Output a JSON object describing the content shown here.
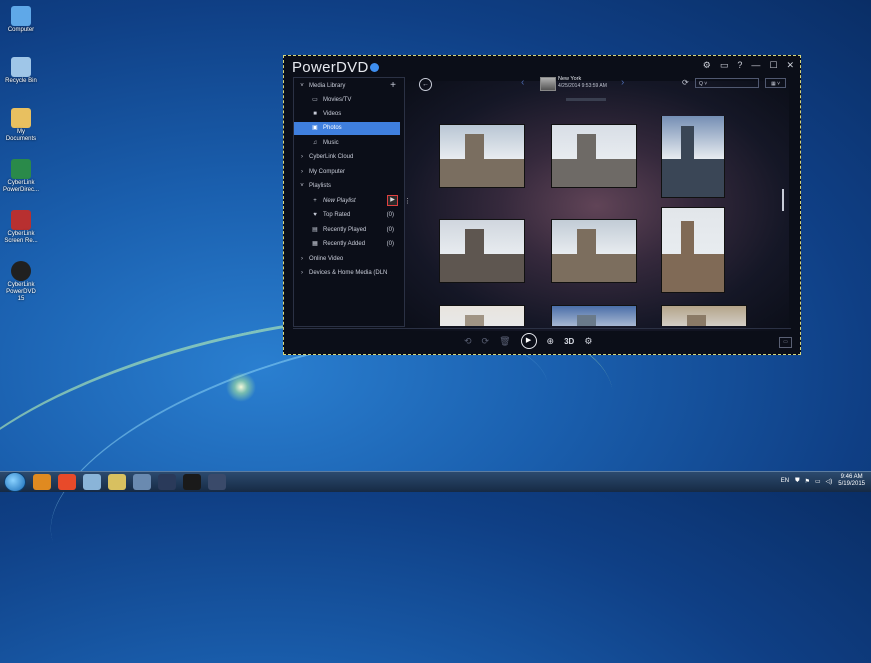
{
  "desktop": {
    "icons": [
      {
        "label": "Computer",
        "color": "#5fa8e8"
      },
      {
        "label": "Recycle Bin",
        "color": "#9fc6e8"
      },
      {
        "label": "My Documents",
        "color": "#e8c060"
      },
      {
        "label": "CyberLink PowerDirec...",
        "color": "#2a8a4a"
      },
      {
        "label": "CyberLink Screen Re...",
        "color": "#b83030"
      },
      {
        "label": "CyberLink PowerDVD 15",
        "color": "#202020"
      }
    ]
  },
  "app": {
    "title": "PowerDVD",
    "window_controls": [
      "⚙",
      "▭",
      "?",
      "—",
      "☐",
      "✕"
    ]
  },
  "sidebar": {
    "media_library": "Media Library",
    "add_symbol": "+",
    "items": [
      {
        "label": "Movies/TV",
        "icon": "▭"
      },
      {
        "label": "Videos",
        "icon": "■"
      },
      {
        "label": "Photos",
        "icon": "▣"
      },
      {
        "label": "Music",
        "icon": "♫"
      }
    ],
    "cyberlink_cloud": "CyberLink Cloud",
    "my_computer": "My Computer",
    "playlists": "Playlists",
    "playlist_items": [
      {
        "label": "New Playlist",
        "icon": "+",
        "count": ""
      },
      {
        "label": "Top Rated",
        "icon": "♥",
        "count": "(0)"
      },
      {
        "label": "Recently Played",
        "icon": "▤",
        "count": "(0)"
      },
      {
        "label": "Recently Added",
        "icon": "▦",
        "count": "(0)"
      }
    ],
    "online_video": "Online Video",
    "devices": "Devices & Home Media (DLN"
  },
  "topbar": {
    "location_name": "New York",
    "location_date": "4/25/2014 9:53:59 AM",
    "search_placeholder": "Q ˅",
    "view_label": "▦ ˅"
  },
  "photos": [
    {
      "sky": "#b9c6d4",
      "bld": "#7a6e60"
    },
    {
      "sky": "#d8dee6",
      "bld": "#6e6a66"
    },
    {
      "sky": "#6d88b0",
      "bld": "#3a4656"
    },
    {
      "sky": "#d0d6de",
      "bld": "#5e5650"
    },
    {
      "sky": "#c2ccd6",
      "bld": "#7c6e5e"
    },
    {
      "sky": "#e2e6ea",
      "bld": "#806a56"
    },
    {
      "sky": "#e8e4de",
      "bld": "#a09484"
    },
    {
      "sky": "#4a6ea8",
      "bld": "#6a7a8a"
    },
    {
      "sky": "#b4a48a",
      "bld": "#8a7a66"
    }
  ],
  "controls": {
    "labels": [
      "⟲",
      "⟳",
      "🗑",
      "▶",
      "⊕",
      "3D",
      "⚙"
    ]
  },
  "taskbar": {
    "items": [
      "#e08a20",
      "#e84a2a",
      "#8ab4d8",
      "#d8c060",
      "#6a8ab0",
      "#2a3a5a",
      "#1a1a1a",
      "#3a4a6a"
    ],
    "lang": "EN",
    "time": "9:46 AM",
    "date": "5/19/2015"
  },
  "colors": {
    "accent": "#3f7fde",
    "highlight_border": "#e04040"
  }
}
